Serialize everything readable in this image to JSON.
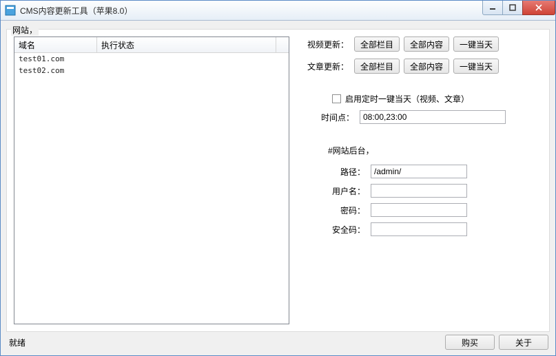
{
  "window": {
    "title": "CMS内容更新工具（苹果8.0）"
  },
  "group": {
    "label": "网站，"
  },
  "table": {
    "headers": {
      "domain": "域名",
      "status": "执行状态"
    },
    "rows": [
      {
        "domain": "test01.com",
        "status": ""
      },
      {
        "domain": "test02.com",
        "status": ""
      }
    ]
  },
  "updates": {
    "video": {
      "label": "视频更新：",
      "b1": "全部栏目",
      "b2": "全部内容",
      "b3": "一键当天"
    },
    "article": {
      "label": "文章更新：",
      "b1": "全部栏目",
      "b2": "全部内容",
      "b3": "一键当天"
    }
  },
  "schedule": {
    "checkbox_label": "启用定时一键当天（视频、文章）",
    "time_label": "时间点：",
    "time_value": "08:00,23:00"
  },
  "backend": {
    "header": "#网站后台，",
    "path_label": "路径：",
    "path_value": "/admin/",
    "user_label": "用户名：",
    "user_value": "",
    "pass_label": "密码：",
    "pass_value": "",
    "code_label": "安全码：",
    "code_value": ""
  },
  "statusbar": {
    "text": "就绪",
    "buy": "购买",
    "about": "关于"
  }
}
